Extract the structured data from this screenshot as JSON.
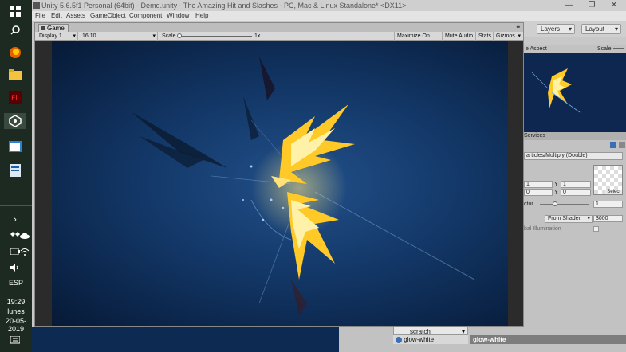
{
  "window": {
    "title": "Unity 5.6.5f1 Personal (64bit) - Demo.unity - The Amazing Hit and Slashes - PC, Mac & Linux Standalone* <DX11>",
    "minimize": "—",
    "maximize": "❐",
    "close": "✕"
  },
  "menu": [
    "File",
    "Edit",
    "Assets",
    "GameObject",
    "Component",
    "Window",
    "Help"
  ],
  "toolbar": {
    "layers": "Layers",
    "layout": "Layout"
  },
  "taskbar": {
    "language": "ESP",
    "time": "19:29",
    "day": "lunes",
    "date": "20-05-2019"
  },
  "game": {
    "tab": "Game",
    "display": "Display 1",
    "aspect": "16:10",
    "scale_label": "Scale",
    "scale_value": "1x",
    "maximize_on_play": "Maximize On Play",
    "mute_audio": "Mute Audio",
    "stats": "Stats",
    "gizmos": "Gizmos"
  },
  "scene": {
    "aspect": "e Aspect",
    "scale": "Scale"
  },
  "inspector": {
    "services": "Services",
    "shader": "articles/Multiply (Double)",
    "x1_label": "X",
    "x1": "1",
    "y1_label": "Y",
    "y1": "1",
    "x2": "0",
    "y2_label": "Y",
    "y2": "0",
    "select": "Select",
    "factor_label": "ctor",
    "factor_value": "1",
    "from_shader": "From Shader",
    "render_queue": "3000",
    "global_illumination": "bal Illumination"
  },
  "bottom": {
    "scratch": "scratch",
    "glow_left": "glow-white",
    "glow_right": "glow-white"
  },
  "colors": {
    "flame_yellow": "#ffd23a",
    "flame_core": "#fff6c0",
    "bg_blue": "#133868"
  }
}
